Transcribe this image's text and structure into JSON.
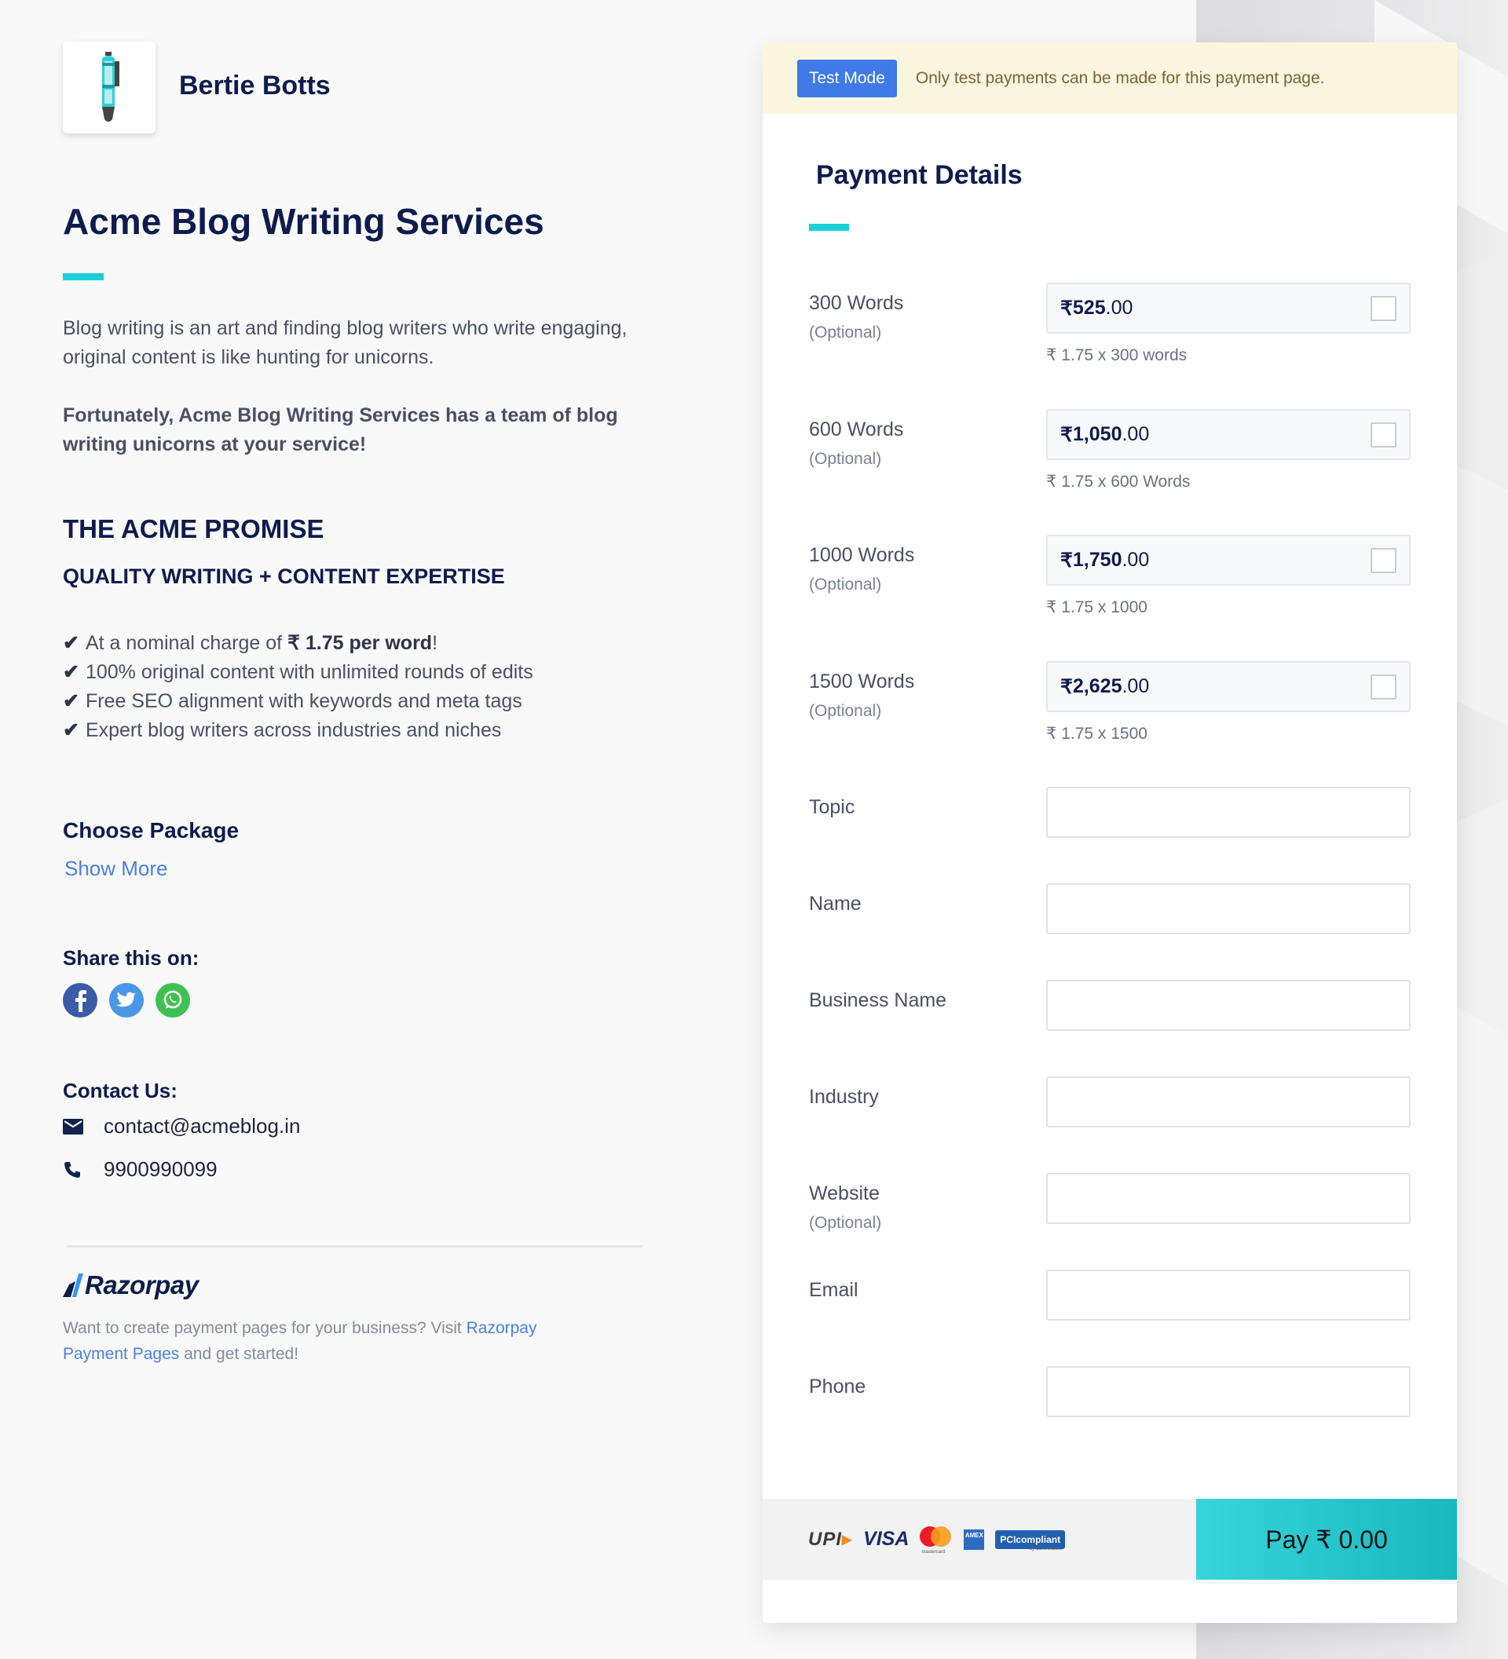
{
  "merchant": {
    "name": "Bertie Botts",
    "logo_icon": "pen-icon"
  },
  "page": {
    "title": "Acme Blog Writing Services",
    "description": "Blog writing is an art and finding blog writers who write engaging, original content is like hunting for unicorns.",
    "description_bold": "Fortunately, Acme Blog Writing Services has a team of blog writing unicorns at your service!",
    "promise_heading": "THE ACME PROMISE",
    "promise_subheading": "QUALITY WRITING + CONTENT EXPERTISE",
    "checklist": [
      {
        "prefix": "At a nominal charge of ",
        "bold": "₹ 1.75 per word",
        "suffix": "!"
      },
      {
        "prefix": "100% original content with unlimited rounds of edits",
        "bold": "",
        "suffix": ""
      },
      {
        "prefix": "Free SEO alignment with keywords and meta tags",
        "bold": "",
        "suffix": ""
      },
      {
        "prefix": "Expert blog writers across industries and niches",
        "bold": "",
        "suffix": ""
      }
    ],
    "check_glyph": "✔",
    "choose_package": "Choose Package",
    "show_more": "Show More",
    "share_label": "Share this on:",
    "share_icons": [
      "facebook-icon",
      "twitter-icon",
      "whatsapp-icon"
    ],
    "contact_label": "Contact Us:",
    "contact_email": "contact@acmeblog.in",
    "contact_phone": "9900990099"
  },
  "razorpay": {
    "logo_text": "Razorpay",
    "note_prefix": "Want to create payment pages for your business? Visit ",
    "note_link": "Razorpay Payment Pages",
    "note_suffix": " and get started!"
  },
  "banner": {
    "badge": "Test Mode",
    "message": "Only test payments can be made for this payment page."
  },
  "payment": {
    "title": "Payment Details",
    "items": [
      {
        "label": "300 Words",
        "optional": "(Optional)",
        "currency": "₹",
        "amount_main": "525",
        "amount_decimal": ".00",
        "hint": "₹ 1.75 x 300 words",
        "checked": false
      },
      {
        "label": "600 Words",
        "optional": "(Optional)",
        "currency": "₹",
        "amount_main": "1,050",
        "amount_decimal": ".00",
        "hint": "₹ 1.75 x 600 Words",
        "checked": false
      },
      {
        "label": "1000 Words",
        "optional": "(Optional)",
        "currency": "₹",
        "amount_main": "1,750",
        "amount_decimal": ".00",
        "hint": "₹ 1.75 x 1000",
        "checked": false
      },
      {
        "label": "1500 Words",
        "optional": "(Optional)",
        "currency": "₹",
        "amount_main": "2,625",
        "amount_decimal": ".00",
        "hint": "₹ 1.75 x 1500",
        "checked": false
      }
    ],
    "fields": [
      {
        "label": "Topic",
        "optional": "",
        "value": ""
      },
      {
        "label": "Name",
        "optional": "",
        "value": ""
      },
      {
        "label": "Business Name",
        "optional": "",
        "value": ""
      },
      {
        "label": "Industry",
        "optional": "",
        "value": ""
      },
      {
        "label": "Website",
        "optional": "(Optional)",
        "value": ""
      },
      {
        "label": "Email",
        "optional": "",
        "value": ""
      },
      {
        "label": "Phone",
        "optional": "",
        "value": ""
      }
    ],
    "payment_methods": [
      "UPI",
      "VISA",
      "mastercard",
      "AMEX",
      "PCIcompliant"
    ],
    "pci_sub": "by ControlCase",
    "mastercard_text": "mastercard",
    "pay_button": "Pay  ₹ 0.00"
  },
  "colors": {
    "accent_teal": "#1bcfd6",
    "navy": "#0e1b4d",
    "test_badge": "#3f7ae6",
    "banner_bg": "#fbf6df",
    "link": "#4a7fe0"
  }
}
